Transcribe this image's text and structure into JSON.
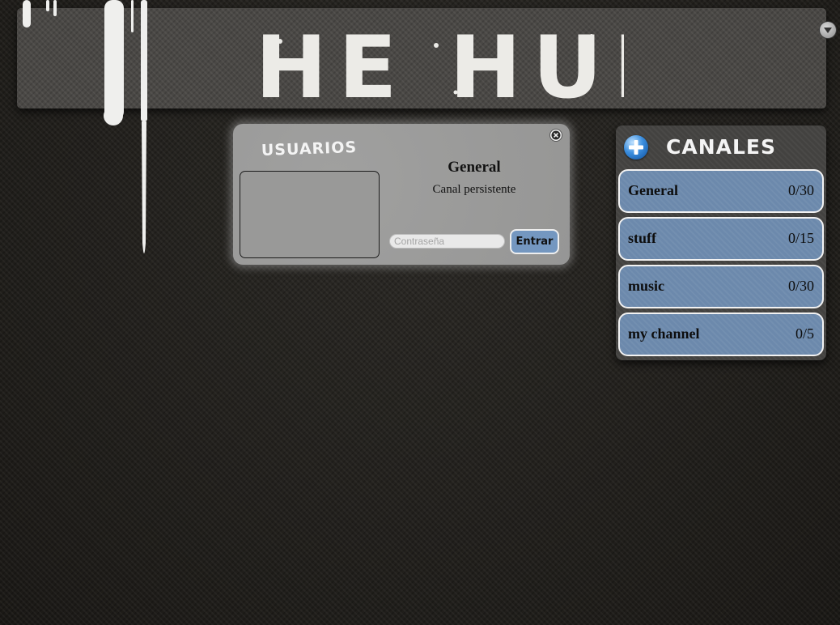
{
  "header": {
    "logo_text": "THE HUB",
    "menu_icon": "chevron-down-circle-icon"
  },
  "users_panel": {
    "title": "USUARIOS",
    "users": []
  },
  "channel_detail": {
    "name": "General",
    "type": "Canal persistente",
    "password_placeholder": "Contraseña",
    "password_value": "",
    "enter_label": "Entrar",
    "close_icon": "close-icon"
  },
  "channels_panel": {
    "title": "CANALES",
    "add_icon": "plus-circle-icon",
    "channels": [
      {
        "name": "General",
        "count": "0/30"
      },
      {
        "name": "stuff",
        "count": "0/15"
      },
      {
        "name": "music",
        "count": "0/30"
      },
      {
        "name": "my channel",
        "count": "0/5"
      }
    ]
  },
  "colors": {
    "background": "#23211e",
    "header_bg": "#4a4845",
    "popup_bg": "#9b9b9a",
    "channel_item_bg": "#6c89ac",
    "enter_button_bg": "#7497c0",
    "text_light": "#ecebe7"
  }
}
